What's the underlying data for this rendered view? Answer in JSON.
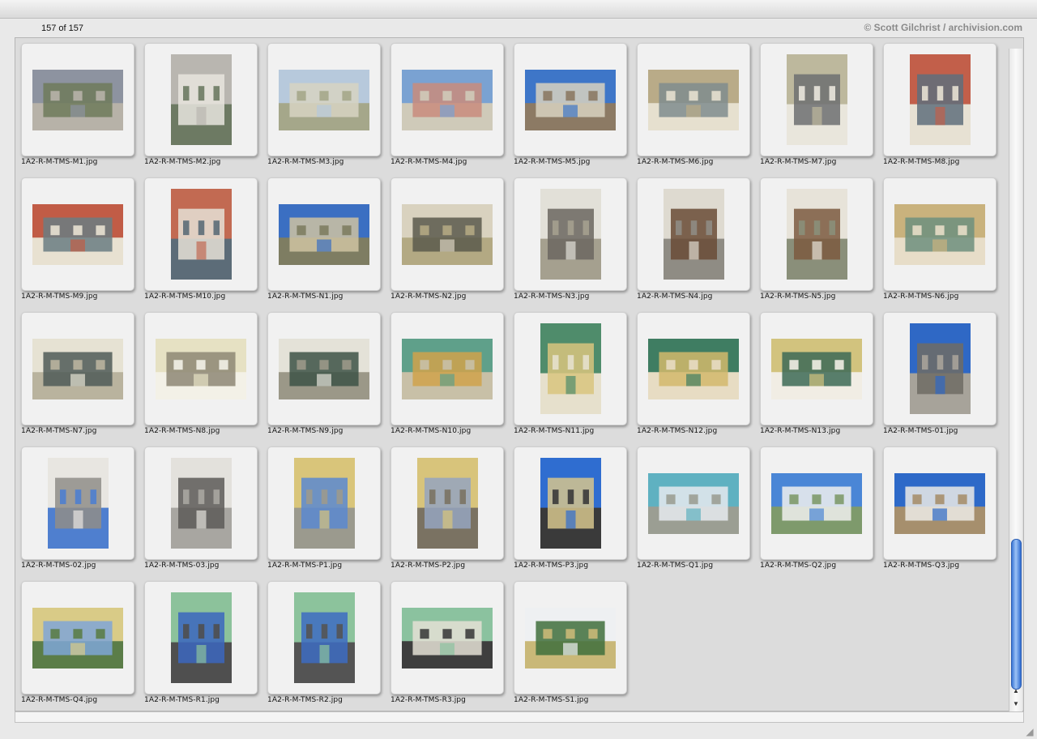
{
  "header": {
    "count_label": "157 of 157",
    "copyright": "© Scott Gilchrist / archivision.com"
  },
  "icons": {
    "scroll_up": "▲",
    "scroll_down": "▼",
    "resize": "◢"
  },
  "thumbnails": [
    {
      "name": "1A2-R-M-TMS-M1.jpg",
      "orient": "landscape",
      "palette": [
        "#8d93a0",
        "#6f7a5a",
        "#b7b2a8"
      ]
    },
    {
      "name": "1A2-R-M-TMS-M2.jpg",
      "orient": "portrait",
      "palette": [
        "#b9b6b0",
        "#e8e5de",
        "#6d7a63"
      ]
    },
    {
      "name": "1A2-R-M-TMS-M3.jpg",
      "orient": "landscape",
      "palette": [
        "#b7c9dc",
        "#d7d4c2",
        "#a5a78a"
      ]
    },
    {
      "name": "1A2-R-M-TMS-M4.jpg",
      "orient": "landscape",
      "palette": [
        "#7aa2d2",
        "#c98c7c",
        "#cfcab9"
      ]
    },
    {
      "name": "1A2-R-M-TMS-M5.jpg",
      "orient": "landscape",
      "palette": [
        "#3e76c8",
        "#d8d2c0",
        "#8c7a64"
      ]
    },
    {
      "name": "1A2-R-M-TMS-M6.jpg",
      "orient": "landscape",
      "palette": [
        "#b9ab88",
        "#7f8c8e",
        "#e6e0cf"
      ]
    },
    {
      "name": "1A2-R-M-TMS-M7.jpg",
      "orient": "portrait",
      "palette": [
        "#bdb89d",
        "#6d6f71",
        "#e9e6dc"
      ]
    },
    {
      "name": "1A2-R-M-TMS-M8.jpg",
      "orient": "portrait",
      "palette": [
        "#c25f4a",
        "#5f6e7b",
        "#e7e1d3"
      ]
    },
    {
      "name": "1A2-R-M-TMS-M9.jpg",
      "orient": "landscape",
      "palette": [
        "#c15c46",
        "#6a7c82",
        "#e8e1d1"
      ]
    },
    {
      "name": "1A2-R-M-TMS-M10.jpg",
      "orient": "portrait",
      "palette": [
        "#c26a52",
        "#e5e1d6",
        "#5c6c78"
      ]
    },
    {
      "name": "1A2-R-M-TMS-N1.jpg",
      "orient": "landscape",
      "palette": [
        "#3b6fc2",
        "#cfc3a2",
        "#7e7d62"
      ]
    },
    {
      "name": "1A2-R-M-TMS-N2.jpg",
      "orient": "landscape",
      "palette": [
        "#d9d2bf",
        "#5a5a4c",
        "#b3a983"
      ]
    },
    {
      "name": "1A2-R-M-TMS-N3.jpg",
      "orient": "portrait",
      "palette": [
        "#e2e0d8",
        "#6b6660",
        "#a5a08f"
      ]
    },
    {
      "name": "1A2-R-M-TMS-N4.jpg",
      "orient": "portrait",
      "palette": [
        "#dedad0",
        "#6a4b36",
        "#8f8c84"
      ]
    },
    {
      "name": "1A2-R-M-TMS-N5.jpg",
      "orient": "portrait",
      "palette": [
        "#e7e3d9",
        "#7b5b3f",
        "#8a8f7a"
      ]
    },
    {
      "name": "1A2-R-M-TMS-N6.jpg",
      "orient": "landscape",
      "palette": [
        "#c9b27d",
        "#6d8f7e",
        "#e7ddc8"
      ]
    },
    {
      "name": "1A2-R-M-TMS-N7.jpg",
      "orient": "landscape",
      "palette": [
        "#e6e2d3",
        "#4f5a57",
        "#b9b39e"
      ]
    },
    {
      "name": "1A2-R-M-TMS-N8.jpg",
      "orient": "landscape",
      "palette": [
        "#e6e1c3",
        "#8d8774",
        "#f3f1e7"
      ]
    },
    {
      "name": "1A2-R-M-TMS-N9.jpg",
      "orient": "landscape",
      "palette": [
        "#e4e2d8",
        "#3d5246",
        "#9b9888"
      ]
    },
    {
      "name": "1A2-R-M-TMS-N10.jpg",
      "orient": "landscape",
      "palette": [
        "#5fa08a",
        "#d0a24b",
        "#c8c0a7"
      ]
    },
    {
      "name": "1A2-R-M-TMS-N11.jpg",
      "orient": "portrait",
      "palette": [
        "#4f8c6b",
        "#d8c47e",
        "#e6e0cc"
      ]
    },
    {
      "name": "1A2-R-M-TMS-N12.jpg",
      "orient": "landscape",
      "palette": [
        "#3f7d62",
        "#d2b86c",
        "#e7dcc3"
      ]
    },
    {
      "name": "1A2-R-M-TMS-N13.jpg",
      "orient": "landscape",
      "palette": [
        "#d2c37e",
        "#3d6a56",
        "#f1ede4"
      ]
    },
    {
      "name": "1A2-R-M-TMS-01.jpg",
      "orient": "portrait",
      "palette": [
        "#2f68c5",
        "#6f6c64",
        "#a7a39a"
      ]
    },
    {
      "name": "1A2-R-M-TMS-02.jpg",
      "orient": "portrait",
      "palette": [
        "#e8e6e1",
        "#8f8d88",
        "#4f7fcf"
      ]
    },
    {
      "name": "1A2-R-M-TMS-03.jpg",
      "orient": "portrait",
      "palette": [
        "#e3e1dc",
        "#5d5b58",
        "#a8a6a1"
      ]
    },
    {
      "name": "1A2-R-M-TMS-P1.jpg",
      "orient": "portrait",
      "palette": [
        "#d9c57a",
        "#5b88d0",
        "#9b9a8e"
      ]
    },
    {
      "name": "1A2-R-M-TMS-P2.jpg",
      "orient": "portrait",
      "palette": [
        "#d8c47b",
        "#95a5c0",
        "#7a7262"
      ]
    },
    {
      "name": "1A2-R-M-TMS-P3.jpg",
      "orient": "portrait",
      "palette": [
        "#2f6dd0",
        "#d6c58d",
        "#3a3a3a"
      ]
    },
    {
      "name": "1A2-R-M-TMS-Q1.jpg",
      "orient": "landscape",
      "palette": [
        "#5fb1c1",
        "#e6eaee",
        "#9b9e93"
      ]
    },
    {
      "name": "1A2-R-M-TMS-Q2.jpg",
      "orient": "landscape",
      "palette": [
        "#4a86d6",
        "#f0f0ee",
        "#7e9a6c"
      ]
    },
    {
      "name": "1A2-R-M-TMS-Q3.jpg",
      "orient": "landscape",
      "palette": [
        "#2d69c8",
        "#ecebe6",
        "#a68f6d"
      ]
    },
    {
      "name": "1A2-R-M-TMS-Q4.jpg",
      "orient": "landscape",
      "palette": [
        "#d9cb87",
        "#7fa6d7",
        "#5b7d48"
      ]
    },
    {
      "name": "1A2-R-M-TMS-R1.jpg",
      "orient": "portrait",
      "palette": [
        "#8cc29b",
        "#3b66be",
        "#4f4f4f"
      ]
    },
    {
      "name": "1A2-R-M-TMS-R2.jpg",
      "orient": "portrait",
      "palette": [
        "#8cc39c",
        "#3d6cc2",
        "#545454"
      ]
    },
    {
      "name": "1A2-R-M-TMS-R3.jpg",
      "orient": "landscape",
      "palette": [
        "#8bc29f",
        "#e4e0d5",
        "#3e3e3e"
      ]
    },
    {
      "name": "1A2-R-M-TMS-S1.jpg",
      "orient": "landscape",
      "palette": [
        "#eef0f2",
        "#3f6e3c",
        "#c9b878"
      ]
    }
  ]
}
